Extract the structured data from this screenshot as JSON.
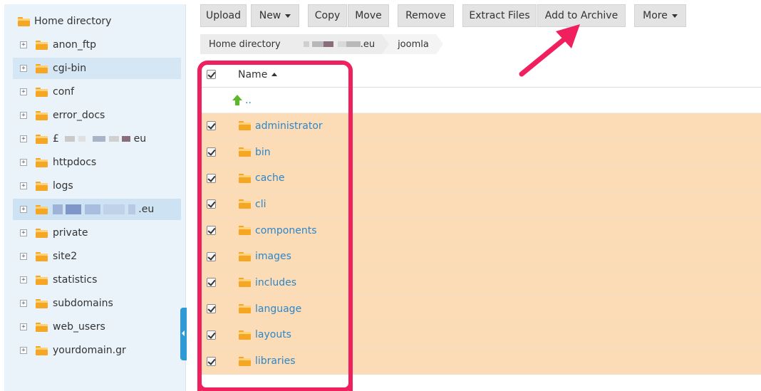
{
  "sidebar": {
    "root_label": "Home directory",
    "items": [
      {
        "label": "anon_ftp"
      },
      {
        "label": "cgi-bin"
      },
      {
        "label": "conf"
      },
      {
        "label": "error_docs"
      },
      {
        "label": "£",
        "suffix": "eu"
      },
      {
        "label": "httpdocs"
      },
      {
        "label": "logs"
      },
      {
        "label": "",
        "suffix": ".eu"
      },
      {
        "label": "private"
      },
      {
        "label": "site2"
      },
      {
        "label": "statistics"
      },
      {
        "label": "subdomains"
      },
      {
        "label": "web_users"
      },
      {
        "label": "yourdomain.gr"
      }
    ]
  },
  "toolbar": {
    "upload": "Upload",
    "new": "New",
    "copy": "Copy",
    "move": "Move",
    "remove": "Remove",
    "extract": "Extract Files",
    "archive": "Add to Archive",
    "more": "More"
  },
  "breadcrumb": {
    "home": "Home directory",
    "domain_suffix": ".eu",
    "current": "joomla"
  },
  "table": {
    "name_header": "Name",
    "parent_link": "..",
    "rows": [
      {
        "name": "administrator"
      },
      {
        "name": "bin"
      },
      {
        "name": "cache"
      },
      {
        "name": "cli"
      },
      {
        "name": "components"
      },
      {
        "name": "images"
      },
      {
        "name": "includes"
      },
      {
        "name": "language"
      },
      {
        "name": "layouts"
      },
      {
        "name": "libraries"
      }
    ]
  },
  "colors": {
    "highlight": "#f0205f",
    "selected_row": "#fbdcb6",
    "link": "#2d86c9",
    "folder": "#f5a623",
    "splitter": "#2e9bd6"
  }
}
